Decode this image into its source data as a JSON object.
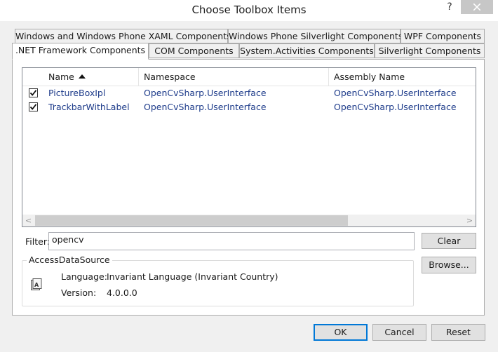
{
  "window": {
    "title": "Choose Toolbox Items",
    "help_glyph": "?"
  },
  "tabs": {
    "row1": [
      "Windows and Windows Phone XAML Components",
      "Windows Phone Silverlight Components",
      "WPF Components"
    ],
    "row2": [
      ".NET Framework Components",
      "COM Components",
      "System.Activities Components",
      "Silverlight Components"
    ],
    "selected": ".NET Framework Components"
  },
  "list": {
    "columns": [
      "Name",
      "Namespace",
      "Assembly Name"
    ],
    "sort_column": "Name",
    "sort_direction": "ascending",
    "rows": [
      {
        "checked": true,
        "name": "PictureBoxIpl",
        "namespace": "OpenCvSharp.UserInterface",
        "assembly": "OpenCvSharp.UserInterface"
      },
      {
        "checked": true,
        "name": "TrackbarWithLabel",
        "namespace": "OpenCvSharp.UserInterface",
        "assembly": "OpenCvSharp.UserInterface"
      }
    ],
    "scroll_left_glyph": "<",
    "scroll_right_glyph": ">"
  },
  "filter": {
    "label": "Filter:",
    "value": "opencv"
  },
  "buttons": {
    "clear": "Clear",
    "browse": "Browse...",
    "ok": "OK",
    "cancel": "Cancel",
    "reset": "Reset"
  },
  "details": {
    "title": "AccessDataSource",
    "language_label": "Language:",
    "language_value": "Invariant Language (Invariant Country)",
    "version_label": "Version:",
    "version_value": "4.0.0.0",
    "icon": "component-icon"
  },
  "colors": {
    "link_text": "#1d3b8a",
    "default_button_border": "#0078d7",
    "close_button_bg": "#c7c7c7"
  }
}
